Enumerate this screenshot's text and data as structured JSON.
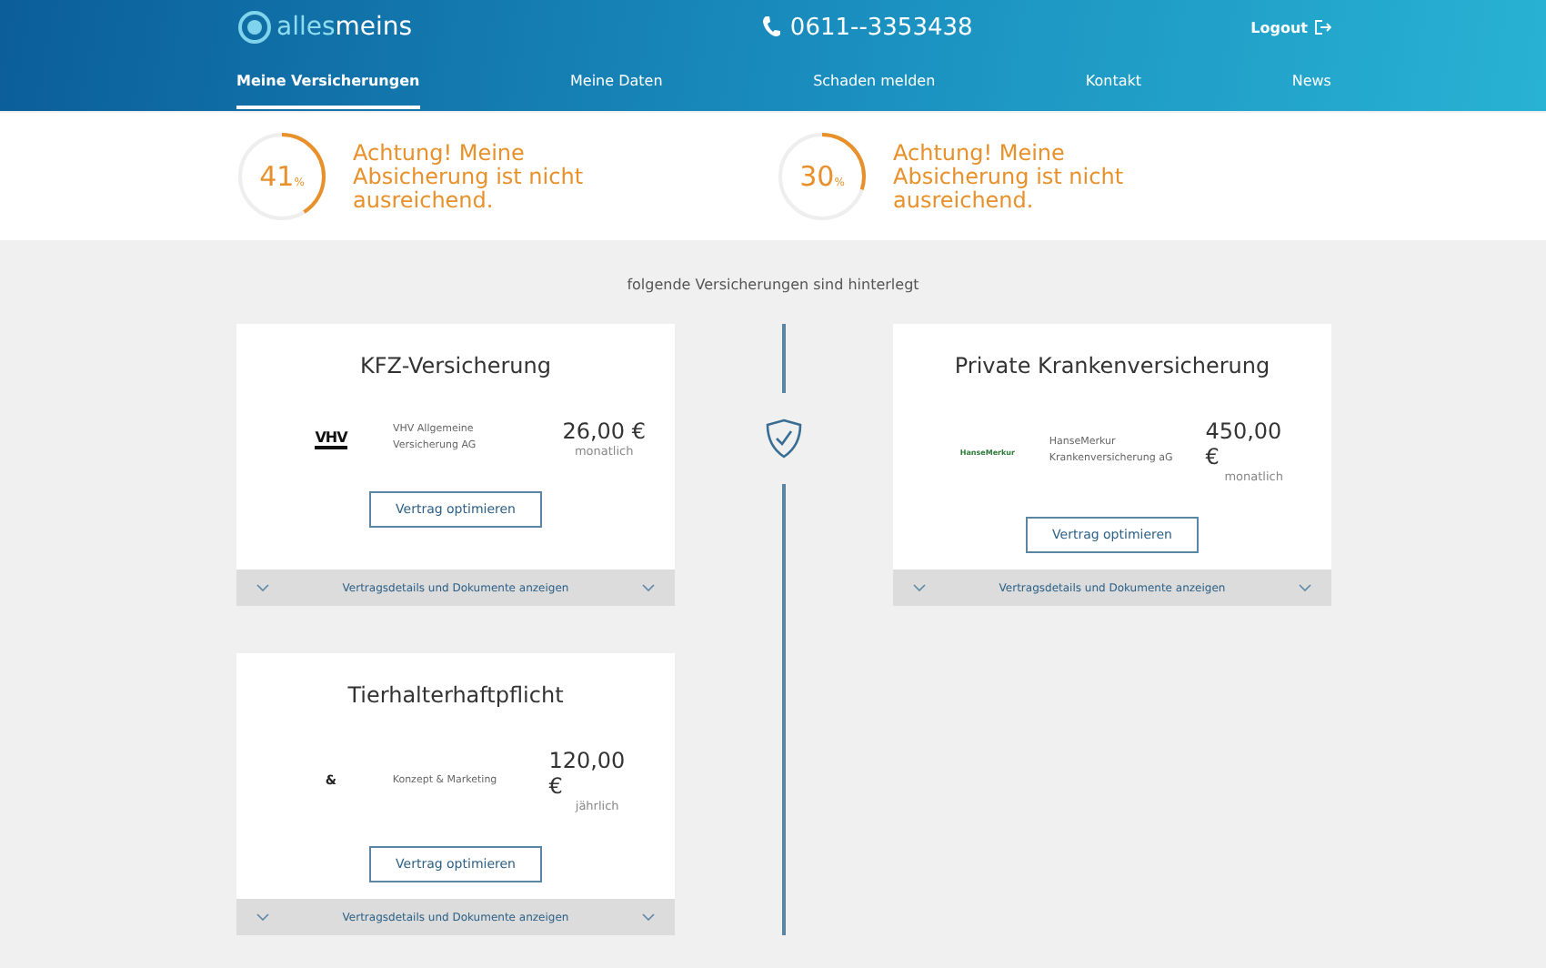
{
  "header": {
    "logo": {
      "part_1": "alles",
      "part_2": "meins"
    },
    "phone": "0611--3353438",
    "logout": "Logout"
  },
  "nav": [
    {
      "label": "Meine Versicherungen",
      "selected": true
    },
    {
      "label": "Meine Daten",
      "selected": false
    },
    {
      "label": "Schaden melden",
      "selected": false
    },
    {
      "label": "Kontakt",
      "selected": false
    },
    {
      "label": "News",
      "selected": false
    }
  ],
  "scores": [
    {
      "value": "41",
      "unit": "%",
      "level": 0.41,
      "message": "Achtung! Meine Absicherung ist nicht ausreichend."
    },
    {
      "value": "30",
      "unit": "%",
      "level": 0.3,
      "message": "Achtung! Meine Absicherung ist nicht ausreichend."
    }
  ],
  "intro": "folgende Versicherungen sind hinterlegt",
  "contracts": [
    {
      "title": "KFZ-Versicherung",
      "logo_text": "VHV",
      "kind": "vhv",
      "insurer": "VHV Allgemeine Versicherung AG",
      "price": "26,00 €",
      "period": "monatlich",
      "button": "Vertrag optimieren",
      "details": "Vertragsdetails und Dokumente anzeigen"
    },
    {
      "title": "Private Krankenversicherung",
      "logo_text": "HanseMerkur",
      "kind": "hanse",
      "insurer": "HanseMerkur Krankenversicherung aG",
      "price": "450,00 €",
      "period": "monatlich",
      "button": "Vertrag optimieren",
      "details": "Vertragsdetails und Dokumente anzeigen"
    },
    {
      "title": "Tierhalterhaftpflicht",
      "logo_text": "&",
      "kind": "konzept",
      "insurer": "Konzept & Marketing",
      "price": "120,00 €",
      "period": "jährlich",
      "button": "Vertrag optimieren",
      "details": "Vertragsdetails und Dokumente anzeigen"
    }
  ]
}
